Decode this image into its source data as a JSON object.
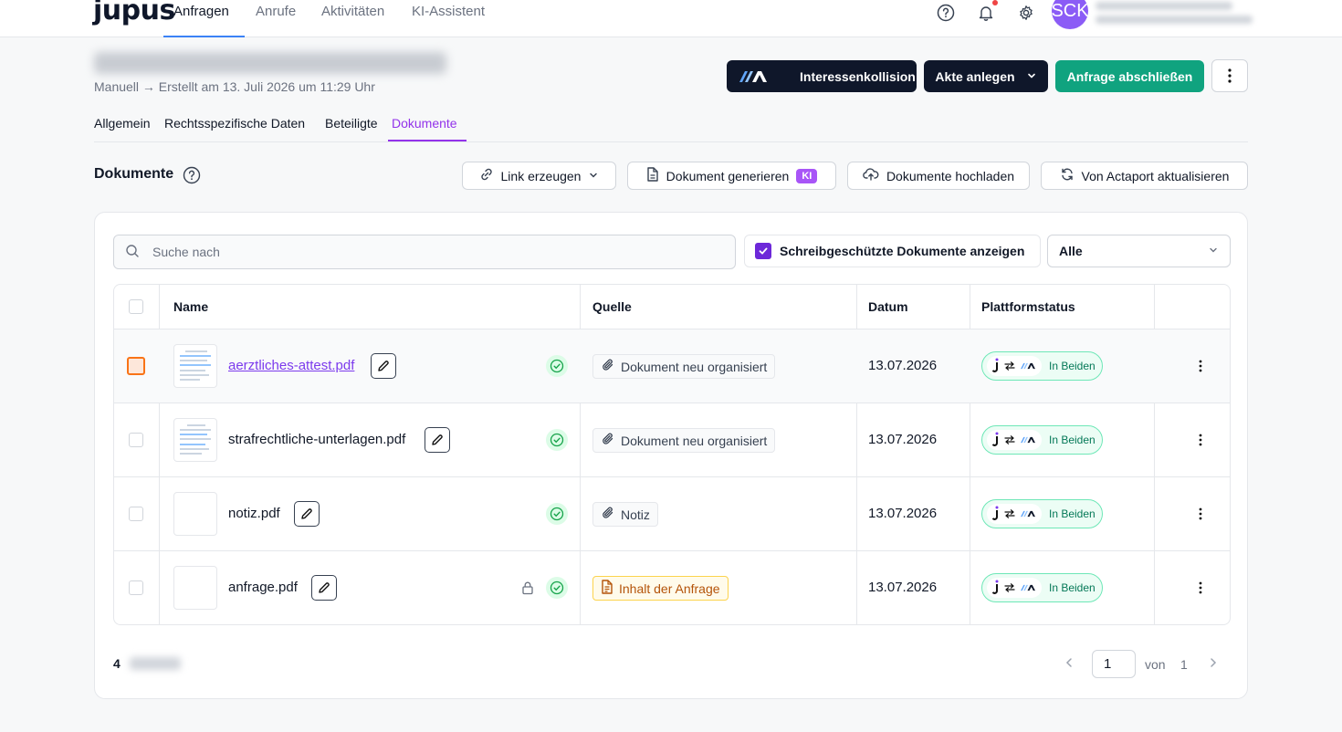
{
  "app": {
    "logo": "jupus"
  },
  "nav": {
    "tabs": [
      "Anfragen",
      "Anrufe",
      "Aktivitäten",
      "KI-Assistent"
    ],
    "active": "Anfragen"
  },
  "user": {
    "initials": "SCK"
  },
  "header": {
    "subtitle": "Manuell → Erstellt am 13. Juli 2026 um 11:29 Uhr",
    "buttons": {
      "conflict": "Interessenkollision",
      "create_file": "Akte anlegen",
      "close_request": "Anfrage abschließen"
    }
  },
  "subtabs": [
    "Allgemein",
    "Rechtsspezifische Daten",
    "Beteiligte",
    "Dokumente"
  ],
  "documents": {
    "title": "Dokumente",
    "toolbar": {
      "link": "Link erzeugen",
      "generate": "Dokument generieren",
      "ki_badge": "KI",
      "upload": "Dokumente hochladen",
      "refresh": "Von Actaport aktualisieren"
    },
    "search_placeholder": "Suche nach",
    "readonly_label": "Schreibgeschützte Dokumente anzeigen",
    "filter_value": "Alle",
    "columns": [
      "Name",
      "Quelle",
      "Datum",
      "Plattformstatus"
    ],
    "rows": [
      {
        "name": "aerztliches-attest.pdf",
        "source": "Dokument neu organisiert",
        "date": "13.07.2026",
        "status": "In Beiden"
      },
      {
        "name": "strafrechtliche-unterlagen.pdf",
        "source": "Dokument neu organisiert",
        "date": "13.07.2026",
        "status": "In Beiden"
      },
      {
        "name": "notiz.pdf",
        "source": "Notiz",
        "date": "13.07.2026",
        "status": "In Beiden"
      },
      {
        "name": "anfrage.pdf",
        "source": "Inhalt der Anfrage",
        "date": "13.07.2026",
        "status": "In Beiden"
      }
    ],
    "total_count": "4",
    "pagination": {
      "current": "1",
      "of_label": "von",
      "total": "1"
    }
  },
  "colors": {
    "accent_purple": "#9333ea",
    "green": "#10a37f",
    "dark": "#0f172a"
  }
}
